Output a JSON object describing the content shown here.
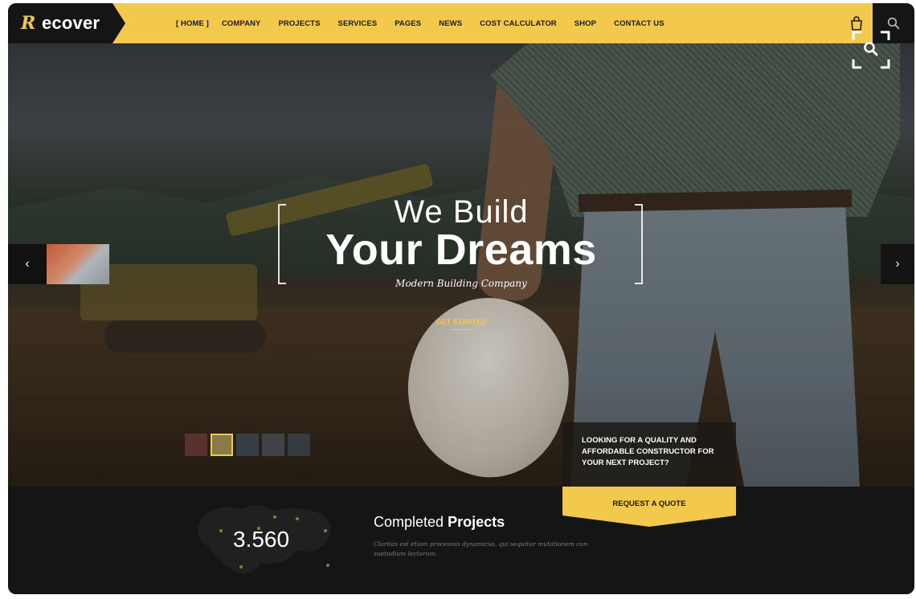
{
  "brand": {
    "mark": "R",
    "name": "ecover"
  },
  "nav": [
    {
      "label": "HOME"
    },
    {
      "label": "COMPANY"
    },
    {
      "label": "PROJECTS"
    },
    {
      "label": "SERVICES"
    },
    {
      "label": "PAGES"
    },
    {
      "label": "NEWS"
    },
    {
      "label": "COST CALCULATOR"
    },
    {
      "label": "SHOP"
    },
    {
      "label": "CONTACT US"
    }
  ],
  "icons": {
    "cart": "shopping-bag-icon",
    "search": "search-icon",
    "zoom": "zoom-expand-icon",
    "prev": "chevron-left-icon",
    "next": "chevron-right-icon"
  },
  "hero": {
    "line1": "We Build",
    "line2": "Your Dreams",
    "tagline": "Modern Building Company",
    "cta": "GET STARTED",
    "prev_arrow": "‹",
    "next_arrow": "›"
  },
  "quote": {
    "text": "LOOKING FOR A QUALITY AND AFFORDABLE CONSTRUCTOR FOR YOUR NEXT PROJECT?",
    "button": "REQUEST A QUOTE"
  },
  "stats": {
    "number": "3.560",
    "title_light": "Completed",
    "title_bold": "Projects",
    "description": "Claritas est etiam processus dynamicus, qui sequitur mutationem con- suetudium lectorum."
  },
  "colors": {
    "accent": "#f2c94c",
    "dark": "#151515"
  }
}
